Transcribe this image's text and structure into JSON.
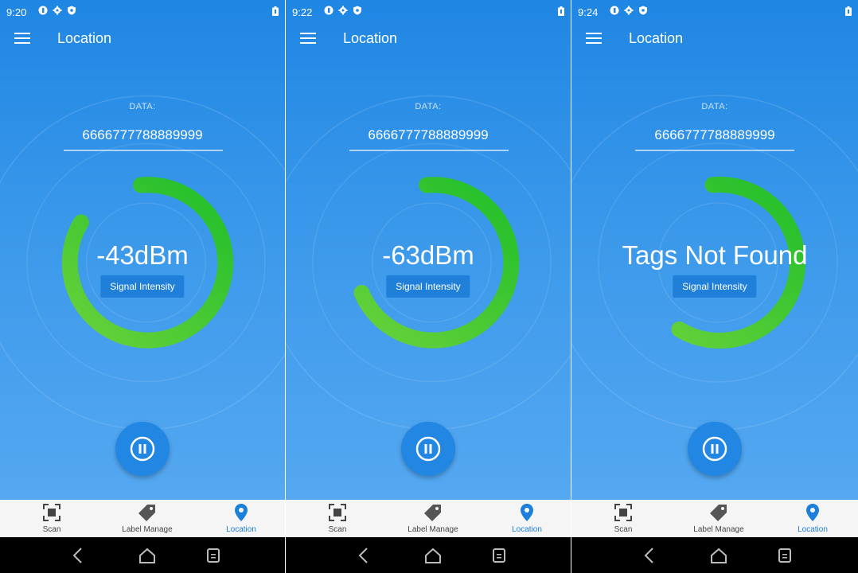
{
  "colors": {
    "accent": "#1c7fdc",
    "gauge_green": "#3cc82a",
    "background_top": "#1f86e3"
  },
  "screens": [
    {
      "status": {
        "time": "9:20"
      },
      "appbar": {
        "title": "Location"
      },
      "data_label": "DATA:",
      "data_value": "6666777788889999",
      "signal": {
        "value": "-43dBm",
        "button_label": "Signal Intensity",
        "gauge_fraction": 0.85
      },
      "nav": {
        "scan": "Scan",
        "label_manage": "Label Manage",
        "location": "Location"
      }
    },
    {
      "status": {
        "time": "9:22"
      },
      "appbar": {
        "title": "Location"
      },
      "data_label": "DATA:",
      "data_value": "6666777788889999",
      "signal": {
        "value": "-63dBm",
        "button_label": "Signal Intensity",
        "gauge_fraction": 0.7
      },
      "nav": {
        "scan": "Scan",
        "label_manage": "Label Manage",
        "location": "Location"
      }
    },
    {
      "status": {
        "time": "9:24"
      },
      "appbar": {
        "title": "Location"
      },
      "data_label": "DATA:",
      "data_value": "6666777788889999",
      "signal": {
        "value": "Tags Not Found",
        "button_label": "Signal Intensity",
        "gauge_fraction": 0.6
      },
      "nav": {
        "scan": "Scan",
        "label_manage": "Label Manage",
        "location": "Location"
      }
    }
  ]
}
